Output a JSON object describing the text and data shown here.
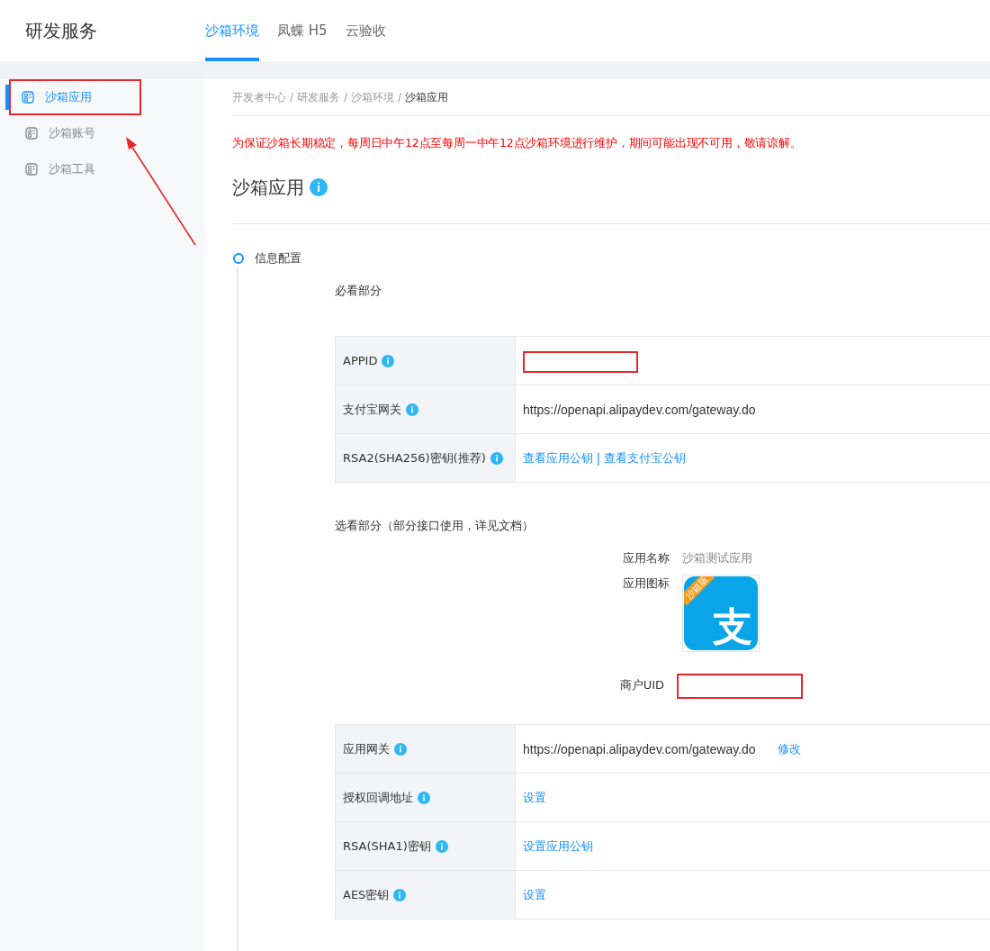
{
  "header": {
    "title": "研发服务",
    "tabs": [
      {
        "label": "沙箱环境",
        "selected": true
      },
      {
        "label": "凤蝶 H5",
        "selected": false
      },
      {
        "label": "云验收",
        "selected": false
      }
    ]
  },
  "sidebar": {
    "items": [
      {
        "label": "沙箱应用",
        "selected": true,
        "highlighted": true
      },
      {
        "label": "沙箱账号",
        "selected": false,
        "highlighted": false
      },
      {
        "label": "沙箱工具",
        "selected": false,
        "highlighted": false
      }
    ]
  },
  "breadcrumb": {
    "separator": "/",
    "items": [
      "开发者中心",
      "研发服务",
      "沙箱环境",
      "沙箱应用"
    ]
  },
  "notice": "为保证沙箱长期稳定，每周日中午12点至每周一中午12点沙箱环境进行维护，期间可能出现不可用，敬请谅解。",
  "page_title": "沙箱应用",
  "step": {
    "title": "信息配置"
  },
  "required": {
    "heading": "必看部分",
    "rows": [
      {
        "label": "APPID",
        "kind": "redacted"
      },
      {
        "label": "支付宝网关",
        "kind": "text",
        "value": "https://openapi.alipaydev.com/gateway.do"
      },
      {
        "label": "RSA2(SHA256)密钥(推荐)",
        "kind": "links",
        "links": [
          "查看应用公钥",
          "查看支付宝公钥"
        ],
        "separator": "|"
      }
    ]
  },
  "optional": {
    "heading": "选看部分（部分接口使用，详见文档）",
    "app_name": {
      "label": "应用名称",
      "value": "沙箱测试应用"
    },
    "app_icon": {
      "label": "应用图标",
      "ribbon": "沙箱版",
      "glyph": "支"
    },
    "merchant_uid": {
      "label": "商户UID"
    },
    "rows": [
      {
        "label": "应用网关",
        "kind": "text_link",
        "value": "https://openapi.alipaydev.com/gateway.do",
        "link": "修改"
      },
      {
        "label": "授权回调地址",
        "kind": "links",
        "links": [
          "设置"
        ]
      },
      {
        "label": "RSA(SHA1)密钥",
        "kind": "links",
        "links": [
          "设置应用公钥"
        ]
      },
      {
        "label": "AES密钥",
        "kind": "links",
        "links": [
          "设置"
        ]
      }
    ]
  }
}
